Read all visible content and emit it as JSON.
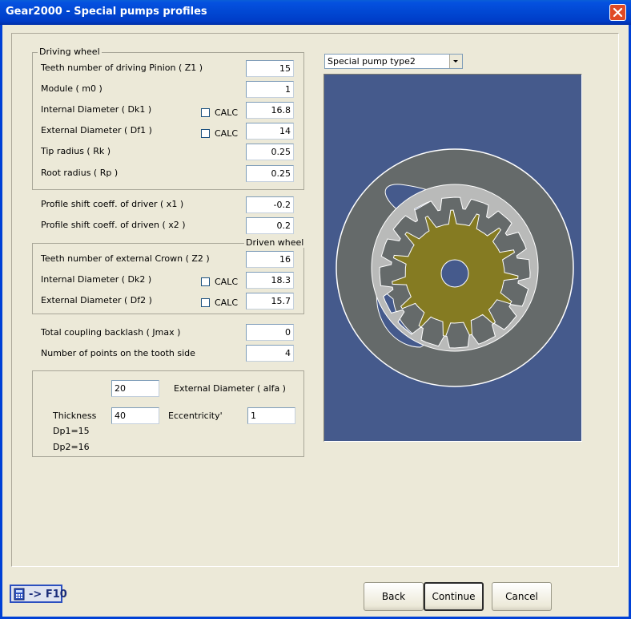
{
  "window": {
    "title": "Gear2000 - Special pumps profiles",
    "close_icon": "close-icon"
  },
  "driving_wheel": {
    "legend": "Driving wheel",
    "teeth_label": "Teeth number of driving Pinion ( Z1 )",
    "teeth_value": "15",
    "module_label": "Module ( m0 )",
    "module_value": "1",
    "internal_label": "Internal Diameter ( Dk1 )",
    "internal_value": "16.8",
    "external_label": "External Diameter ( Df1 )",
    "external_value": "14",
    "tip_label": "Tip radius ( Rk )",
    "tip_value": "0.25",
    "root_label": "Root radius ( Rp )",
    "root_value": "0.25",
    "calc_label": "CALC"
  },
  "shift": {
    "x1_label": "Profile shift coeff. of driver  ( x1 )",
    "x1_value": "-0.2",
    "x2_label": "Profile shift coeff. of driven ( x2 )",
    "x2_value": "0.2"
  },
  "driven_wheel": {
    "legend": "Driven wheel",
    "teeth_label": "Teeth number of external Crown ( Z2 )",
    "teeth_value": "16",
    "internal_label": "Internal Diameter ( Dk2 )",
    "internal_value": "18.3",
    "external_label": "External Diameter ( Df2 )",
    "external_value": "15.7",
    "calc_label": "CALC"
  },
  "misc": {
    "backlash_label": "Total coupling backlash ( Jmax )",
    "backlash_value": "0",
    "points_label": "Number of points on the tooth side",
    "points_value": "4"
  },
  "pump": {
    "alfa_value": "20",
    "alfa_label": "External Diameter ( alfa )",
    "thickness_label": "Thickness",
    "thickness_value": "40",
    "eccentricity_label": "Eccentricity'",
    "eccentricity_value": "1",
    "dp1": "Dp1=15",
    "dp2": "Dp2=16"
  },
  "preview": {
    "pump_type": "Special pump type2",
    "colors": {
      "background": "#455a8c",
      "housing": "#656a6a",
      "crown": "#b9bab9",
      "pinion": "#857b22",
      "outline": "#ffffff"
    },
    "pinion_teeth": 15,
    "crown_teeth": 16
  },
  "buttons": {
    "back": "Back",
    "continue": "Continue",
    "cancel": "Cancel",
    "f10": "-> F10",
    "f10_icon": "calculator-icon"
  }
}
